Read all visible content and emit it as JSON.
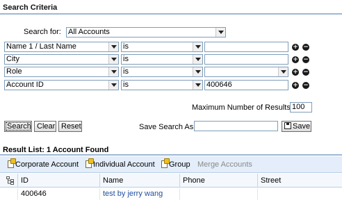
{
  "section_title": "Search Criteria",
  "search_for": {
    "label": "Search for:",
    "value": "All Accounts"
  },
  "criteria": [
    {
      "field": "Name 1 / Last Name",
      "operator": "is",
      "value": ""
    },
    {
      "field": "City",
      "operator": "is",
      "value": ""
    },
    {
      "field": "Role",
      "operator": "is",
      "value": ""
    },
    {
      "field": "Account ID",
      "operator": "is",
      "value": "400646"
    }
  ],
  "max_results": {
    "label": "Maximum Number of Results:",
    "value": "100"
  },
  "buttons": {
    "search": "Search",
    "clear": "Clear",
    "reset": "Reset",
    "save": "Save"
  },
  "save_search": {
    "label": "Save Search As:",
    "value": ""
  },
  "result_title": "Result List: 1 Account Found",
  "toolbar": {
    "corporate": "Corporate Account",
    "individual": "Individual Account",
    "group": "Group",
    "merge": "Merge Accounts"
  },
  "table": {
    "headers": [
      "ID",
      "Name",
      "Phone",
      "Street"
    ],
    "rows": [
      {
        "id": "400646",
        "name": "test by jerry wang",
        "phone": "",
        "street": ""
      }
    ]
  },
  "icons": {
    "add": "plus-circle-icon",
    "remove": "minus-circle-icon",
    "hierarchy": "hierarchy-icon",
    "new_doc": "new-document-icon",
    "save": "save-icon"
  }
}
